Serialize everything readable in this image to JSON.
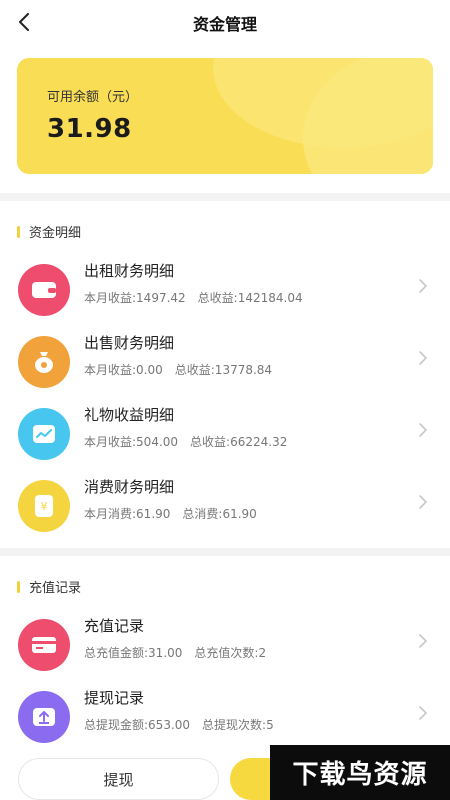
{
  "header": {
    "title": "资金管理"
  },
  "balance": {
    "label": "可用余额（元）",
    "value": "31.98"
  },
  "sections": [
    {
      "title": "资金明细"
    },
    {
      "title": "充值记录"
    }
  ],
  "fund_items": [
    {
      "title": "出租财务明细",
      "sub1": "本月收益:1497.42",
      "sub2": "总收益:142184.04",
      "color": "#ee4d6d"
    },
    {
      "title": "出售财务明细",
      "sub1": "本月收益:0.00",
      "sub2": "总收益:13778.84",
      "color": "#f2a23a"
    },
    {
      "title": "礼物收益明细",
      "sub1": "本月收益:504.00",
      "sub2": "总收益:66224.32",
      "color": "#47c7ef"
    },
    {
      "title": "消费财务明细",
      "sub1": "本月消费:61.90",
      "sub2": "总消费:61.90",
      "color": "#f4d43f"
    }
  ],
  "record_items": [
    {
      "title": "充值记录",
      "sub1": "总充值金额:31.00",
      "sub2": "总充值次数:2",
      "color": "#ee4d6d"
    },
    {
      "title": "提现记录",
      "sub1": "总提现金额:653.00",
      "sub2": "总提现次数:5",
      "color": "#8b6cf0"
    }
  ],
  "buttons": {
    "withdraw": "提现"
  },
  "watermark": "下载鸟资源"
}
